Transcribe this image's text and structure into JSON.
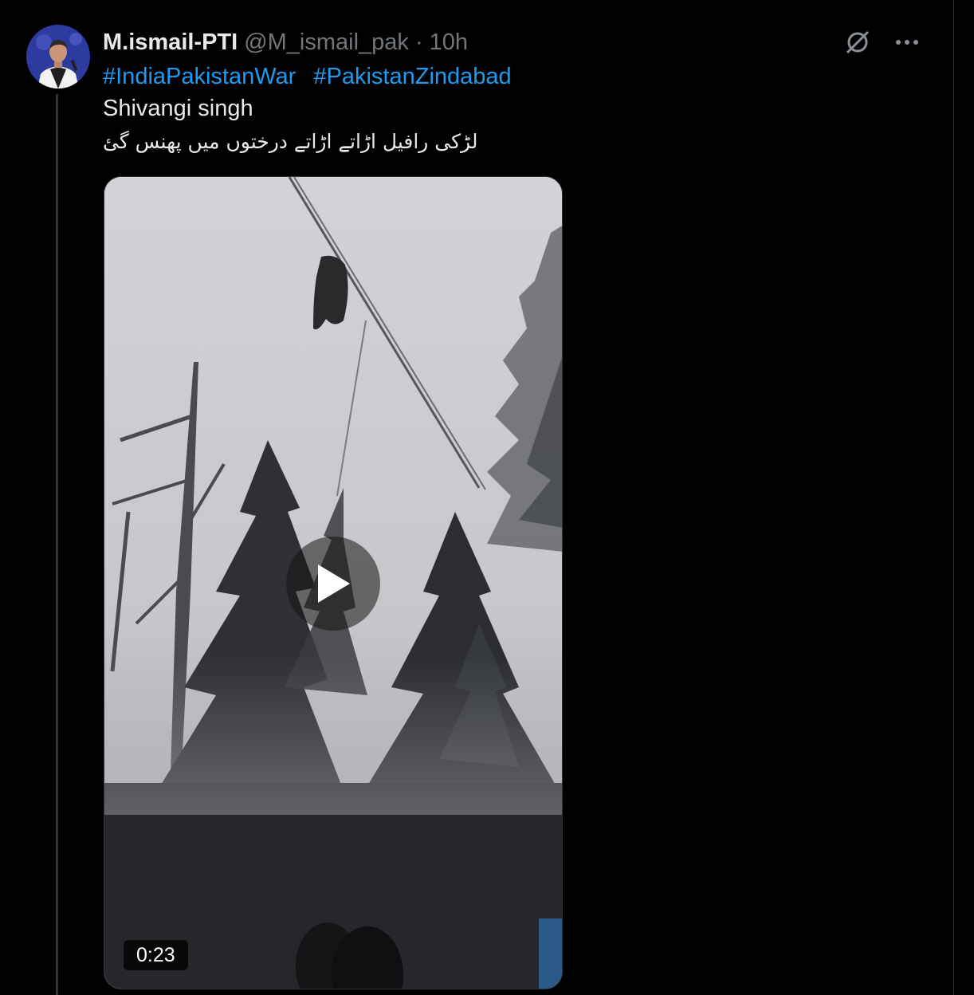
{
  "tweet": {
    "author_name": "M.ismail-PTI",
    "author_handle": "@M_ismail_pak",
    "separator": "·",
    "timestamp": "10h",
    "hashtags": [
      "#IndiaPakistanWar",
      "#PakistanZindabad"
    ],
    "text_line_1": "Shivangi singh",
    "text_line_2": "لڑکی رافیل اڑاتے اڑاتے درختوں میں پھنس گئ",
    "avatar_icon": "profile-avatar",
    "grok_icon": "grok-icon",
    "more_icon": "more-icon"
  },
  "video": {
    "duration": "0:23",
    "play_icon": "play-icon",
    "theme": {
      "sky": "#cfcdd1",
      "trees": "#2b2d30",
      "overlay": "#000000"
    }
  },
  "colors": {
    "background": "#000000",
    "primary_text": "#e7e9ea",
    "secondary_text": "#71767b",
    "link": "#1d9bf0",
    "border": "#2f3336"
  }
}
